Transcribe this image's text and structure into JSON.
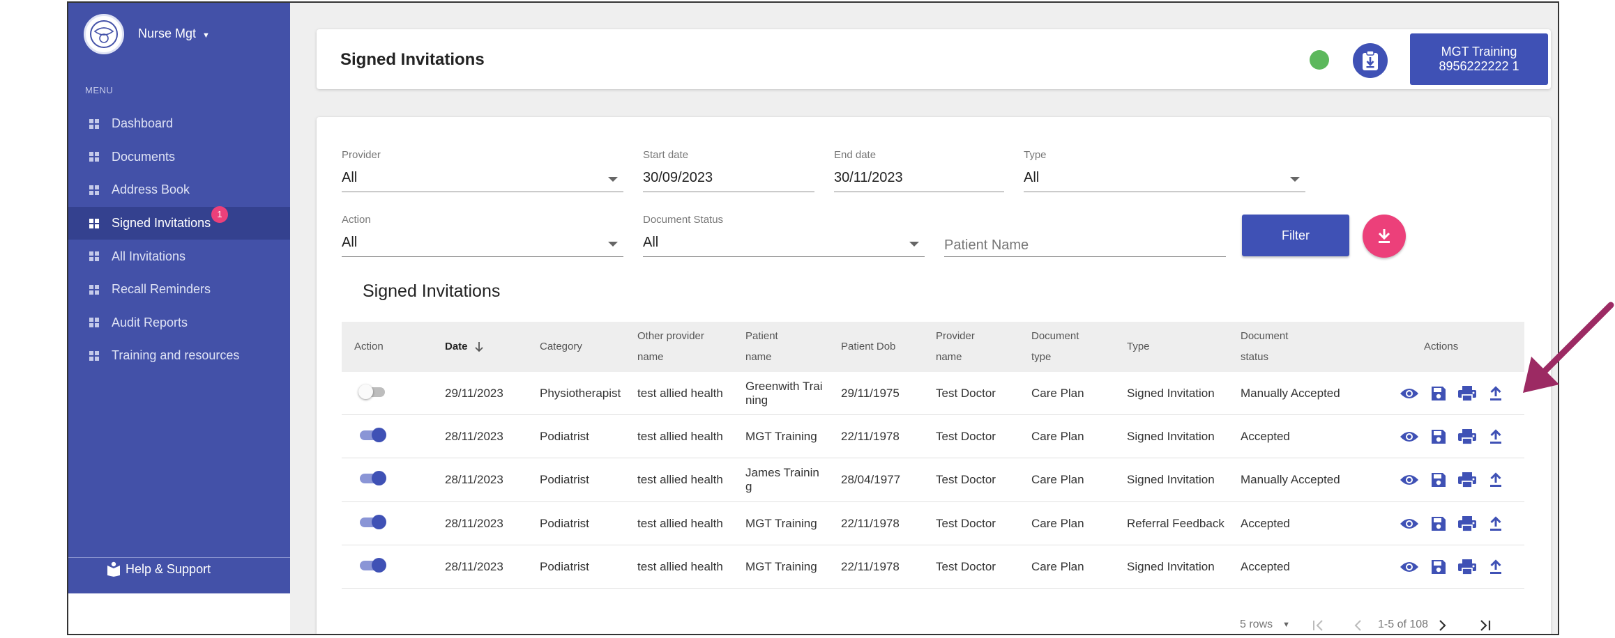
{
  "sidebar": {
    "user_name": "Nurse Mgt",
    "menu_label": "MENU",
    "items": [
      {
        "label": "Dashboard"
      },
      {
        "label": "Documents"
      },
      {
        "label": "Address Book"
      },
      {
        "label": "Signed Invitations",
        "badge": "1",
        "active": true
      },
      {
        "label": "All Invitations"
      },
      {
        "label": "Recall Reminders"
      },
      {
        "label": "Audit Reports"
      },
      {
        "label": "Training and resources"
      }
    ],
    "help_label": "Help & Support"
  },
  "header": {
    "title": "Signed Invitations",
    "status_color": "#5cb85c",
    "account_line1": "MGT Training",
    "account_line2": "8956222222 1"
  },
  "filters": {
    "provider_label": "Provider",
    "provider_value": "All",
    "start_label": "Start date",
    "start_value": "30/09/2023",
    "end_label": "End date",
    "end_value": "30/11/2023",
    "type_label": "Type",
    "type_value": "All",
    "action_label": "Action",
    "action_value": "All",
    "doc_status_label": "Document Status",
    "doc_status_value": "All",
    "patient_placeholder": "Patient Name",
    "filter_button": "Filter"
  },
  "table": {
    "title": "Signed Invitations",
    "headers": {
      "action": "Action",
      "date": "Date",
      "category": "Category",
      "other_provider_1": "Other provider",
      "other_provider_2": "name",
      "patient_1": "Patient",
      "patient_2": "name",
      "dob": "Patient Dob",
      "provider_1": "Provider",
      "provider_2": "name",
      "doctype_1": "Document",
      "doctype_2": "type",
      "type": "Type",
      "docstatus_1": "Document",
      "docstatus_2": "status",
      "actions": "Actions"
    },
    "rows": [
      {
        "toggle": "off",
        "date": "29/11/2023",
        "category": "Physiotherapist",
        "other_provider": "test allied health",
        "patient_1": "Greenwith Trai",
        "patient_2": "ning",
        "dob": "29/11/1975",
        "provider": "Test Doctor",
        "doctype": "Care Plan",
        "type": "Signed Invitation",
        "status": "Manually Accepted"
      },
      {
        "toggle": "on",
        "date": "28/11/2023",
        "category": "Podiatrist",
        "other_provider": "test allied health",
        "patient_1": "MGT Training",
        "patient_2": "",
        "dob": "22/11/1978",
        "provider": "Test Doctor",
        "doctype": "Care Plan",
        "type": "Signed Invitation",
        "status": "Accepted"
      },
      {
        "toggle": "on",
        "date": "28/11/2023",
        "category": "Podiatrist",
        "other_provider": "test allied health",
        "patient_1": "James Trainin",
        "patient_2": "g",
        "dob": "28/04/1977",
        "provider": "Test Doctor",
        "doctype": "Care Plan",
        "type": "Signed Invitation",
        "status": "Manually Accepted"
      },
      {
        "toggle": "on",
        "date": "28/11/2023",
        "category": "Podiatrist",
        "other_provider": "test allied health",
        "patient_1": "MGT Training",
        "patient_2": "",
        "dob": "22/11/1978",
        "provider": "Test Doctor",
        "doctype": "Care Plan",
        "type": "Referral Feedback",
        "status": "Accepted"
      },
      {
        "toggle": "on",
        "date": "28/11/2023",
        "category": "Podiatrist",
        "other_provider": "test allied health",
        "patient_1": "MGT Training",
        "patient_2": "",
        "dob": "22/11/1978",
        "provider": "Test Doctor",
        "doctype": "Care Plan",
        "type": "Signed Invitation",
        "status": "Accepted"
      }
    ],
    "action_icons": [
      "eye-icon",
      "save-icon",
      "print-icon",
      "upload-icon"
    ]
  },
  "pagination": {
    "rows_label": "5 rows",
    "range": "1-5 of 108"
  },
  "colors": {
    "sidebar": "#4351a8",
    "primary": "#3f51b5",
    "accent": "#ec407a",
    "annotation_arrow": "#9c2a63"
  }
}
